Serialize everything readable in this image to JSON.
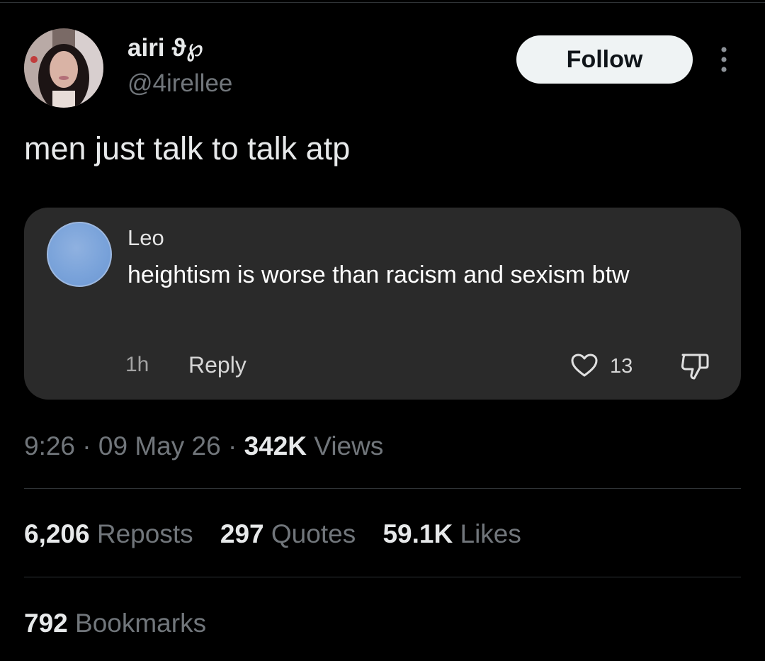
{
  "author": {
    "display_name": "airi ϑ℘",
    "handle": "@4irellee",
    "avatar": "profile-photo"
  },
  "follow_label": "Follow",
  "more_icon": "more-vertical-icon",
  "post_text": "men just talk to talk atp",
  "quoted_comment": {
    "name": "Leo",
    "text": "heightism is worse than racism and sexism btw",
    "time": "1h",
    "reply_label": "Reply",
    "like_count": "13",
    "avatar_color": "#7aa3da",
    "icons": [
      "heart-icon",
      "dislike-icon"
    ]
  },
  "meta": {
    "time": "9:26",
    "separator": "·",
    "date": "09 May 26",
    "views_count": "342K",
    "views_label": "Views"
  },
  "stats": {
    "reposts_count": "6,206",
    "reposts_label": "Reposts",
    "quotes_count": "297",
    "quotes_label": "Quotes",
    "likes_count": "59.1K",
    "likes_label": "Likes",
    "bookmarks_count": "792",
    "bookmarks_label": "Bookmarks"
  },
  "colors": {
    "background": "#000000",
    "text_primary": "#e7e9ea",
    "text_secondary": "#71767b",
    "card_background": "#2a2a2a",
    "follow_button": "#eff3f4"
  }
}
